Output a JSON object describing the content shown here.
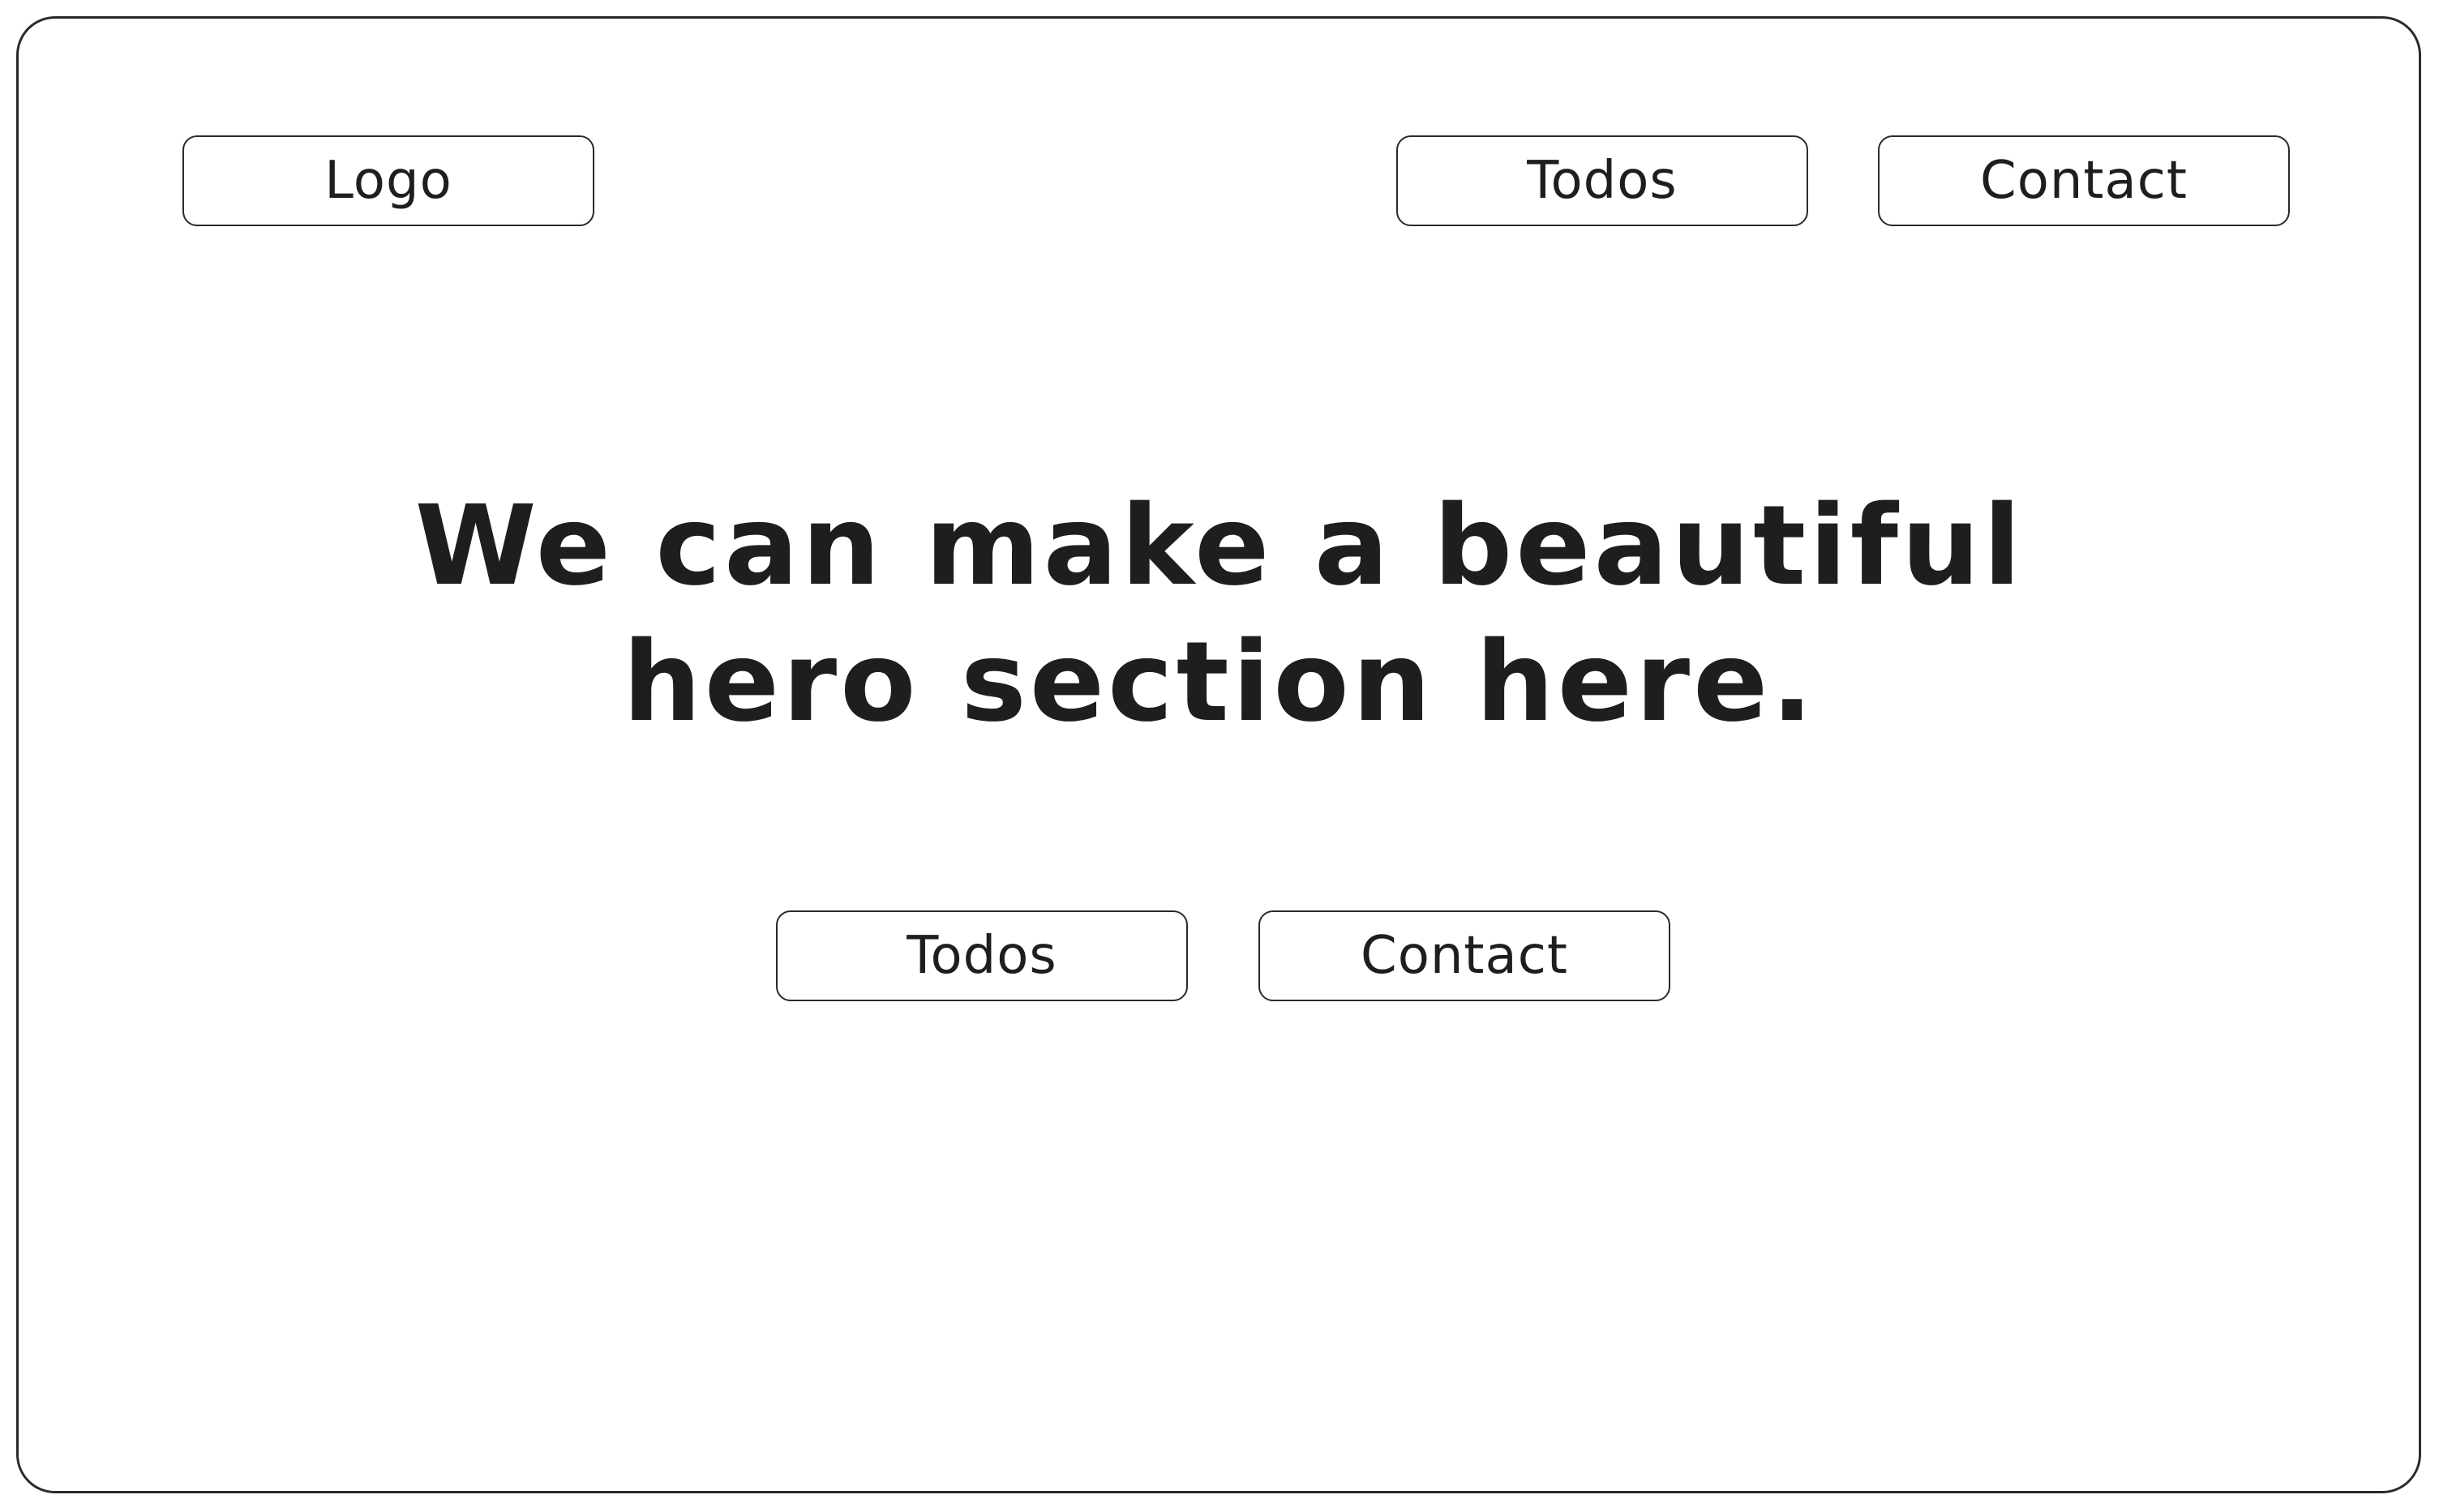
{
  "header": {
    "logo_label": "Logo",
    "nav": [
      {
        "label": "Todos"
      },
      {
        "label": "Contact"
      }
    ]
  },
  "hero": {
    "title_line1": "We can make a beautiful",
    "title_line2": "hero section here.",
    "buttons": [
      {
        "label": "Todos"
      },
      {
        "label": "Contact"
      }
    ]
  },
  "colors": {
    "stroke": "#2a2a2a",
    "text": "#1e1e1e",
    "background": "#ffffff"
  }
}
